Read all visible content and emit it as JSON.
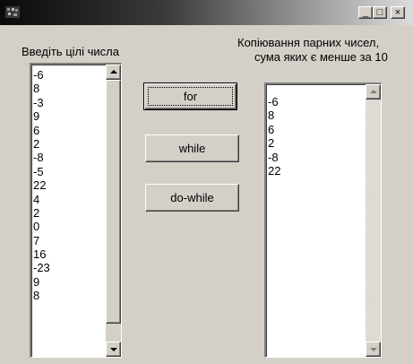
{
  "window": {
    "title": "",
    "buttons": {
      "minimize": "_",
      "maximize": "□",
      "close": "×"
    }
  },
  "left_panel": {
    "label": "Введіть цілі числа",
    "items": [
      "-6",
      "8",
      "-3",
      "9",
      "6",
      "2",
      "-8",
      "-5",
      "22",
      "4",
      "2",
      "0",
      "7",
      "16",
      "-23",
      "9",
      "8"
    ]
  },
  "buttons": {
    "for": "for",
    "while": "while",
    "do_while": "do-while"
  },
  "right_panel": {
    "label_line1": "Копіювання парних чисел,",
    "label_line2": "сума яких є менше за 10",
    "items": [
      "-6",
      "8",
      "6",
      "2",
      "-8",
      "22"
    ]
  },
  "colors": {
    "face": "#d4d0c8",
    "title_dark": "#0a0a0a"
  }
}
